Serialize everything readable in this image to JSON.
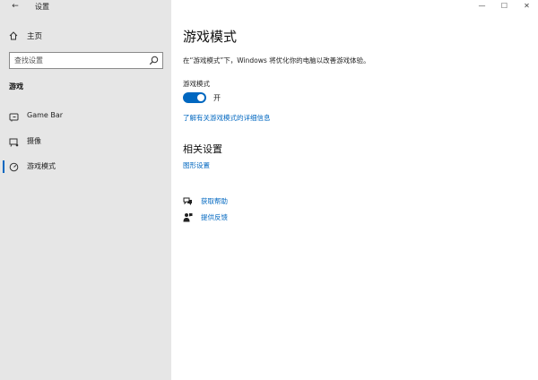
{
  "window": {
    "title": "设置",
    "back_glyph": "←",
    "minimize_glyph": "—",
    "maximize_glyph": "☐",
    "close_glyph": "✕"
  },
  "sidebar": {
    "home_label": "主页",
    "search_placeholder": "查找设置",
    "section_header": "游戏",
    "items": [
      {
        "label": "Game Bar",
        "icon": "game-bar-icon",
        "active": false
      },
      {
        "label": "摄像",
        "icon": "capture-icon",
        "active": false
      },
      {
        "label": "游戏模式",
        "icon": "game-mode-icon",
        "active": true
      }
    ]
  },
  "main": {
    "title": "游戏模式",
    "description": "在“游戏模式”下，Windows 将优化你的电脑以改善游戏体验。",
    "toggle_label": "游戏模式",
    "toggle_state": "开",
    "toggle_on": true,
    "learn_more_link": "了解有关游戏模式的详细信息",
    "related_title": "相关设置",
    "graphics_link": "图形设置",
    "get_help": "获取帮助",
    "give_feedback": "提供反馈"
  },
  "colors": {
    "accent": "#0067c0",
    "sidebar_bg": "#e6e6e6",
    "main_bg": "#ffffff"
  }
}
